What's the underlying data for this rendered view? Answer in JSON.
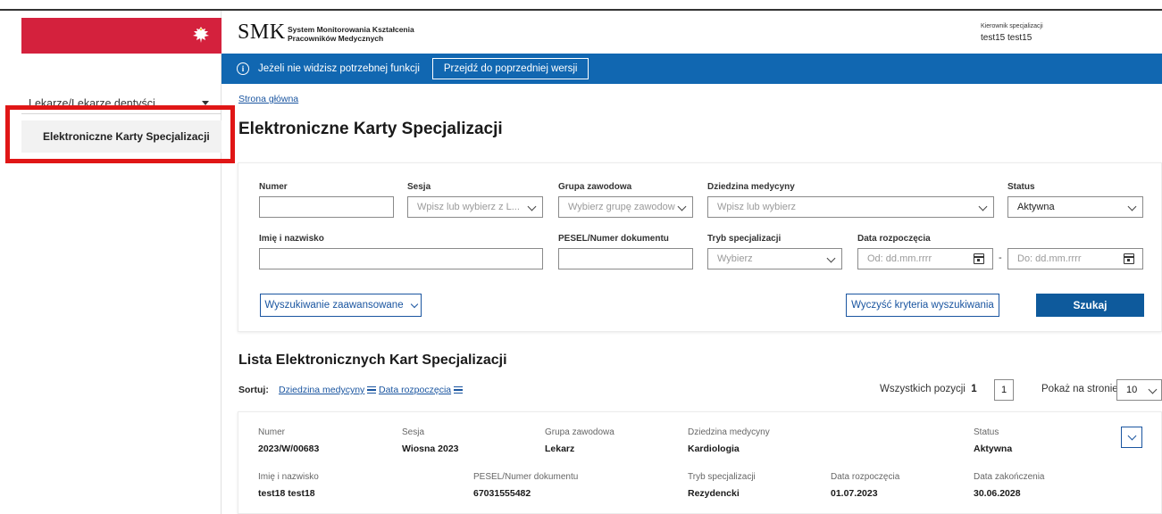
{
  "header": {
    "logo": "SMK",
    "subtitle_line1": "System Monitorowania Kształcenia",
    "subtitle_line2": "Pracowników Medycznych",
    "user_role": "Kierownik specjalizacji",
    "user_name": "test15 test15"
  },
  "info_bar": {
    "text": "Jeżeli nie widzisz potrzebnej funkcji",
    "button_label": "Przejdź do poprzedniej wersji"
  },
  "sidebar": {
    "group_label": "Lekarze/Lekarze dentyści",
    "items": [
      {
        "label": "Elektroniczne Karty Specjalizacji",
        "active": true
      }
    ]
  },
  "breadcrumb": "Strona główna",
  "page_title": "Elektroniczne Karty Specjalizacji",
  "search": {
    "numer_label": "Numer",
    "numer_value": "",
    "sesja_label": "Sesja",
    "sesja_placeholder": "Wpisz lub wybierz z L...",
    "grupa_label": "Grupa zawodowa",
    "grupa_placeholder": "Wybierz grupę zawodow",
    "dziedzina_label": "Dziedzina medycyny",
    "dziedzina_placeholder": "Wpisz lub wybierz",
    "status_label": "Status",
    "status_value": "Aktywna",
    "imie_label": "Imię i nazwisko",
    "imie_value": "",
    "pesel_label": "PESEL/Numer dokumentu",
    "pesel_value": "",
    "tryb_label": "Tryb specjalizacji",
    "tryb_placeholder": "Wybierz",
    "data_label": "Data rozpoczęcia",
    "data_od_placeholder": "Od: dd.mm.rrrr",
    "data_do_placeholder": "Do: dd.mm.rrrr",
    "date_separator": "-",
    "advanced_label": "Wyszukiwanie zaawansowane",
    "clear_label": "Wyczyść kryteria wyszukiwania",
    "search_label": "Szukaj"
  },
  "list": {
    "title": "Lista Elektronicznych Kart Specjalizacji",
    "sort_label": "Sortuj:",
    "sort_options": [
      "Dziedzina medycyny",
      "Data rozpoczęcia"
    ],
    "total_label": "Wszystkich pozycji",
    "total_count": "1",
    "page_number": "1",
    "per_page_label": "Pokaż na stronie",
    "per_page_value": "10",
    "records": [
      {
        "numer_label": "Numer",
        "numer": "2023/W/00683",
        "sesja_label": "Sesja",
        "sesja": "Wiosna 2023",
        "grupa_label": "Grupa zawodowa",
        "grupa": "Lekarz",
        "dziedzina_label": "Dziedzina medycyny",
        "dziedzina": "Kardiologia",
        "status_label": "Status",
        "status": "Aktywna",
        "imie_label": "Imię i nazwisko",
        "imie": "test18 test18",
        "pesel_label": "PESEL/Numer dokumentu",
        "pesel": "67031555482",
        "tryb_label": "Tryb specjalizacji",
        "tryb": "Rezydencki",
        "data_rozp_label": "Data rozpoczęcia",
        "data_rozp": "01.07.2023",
        "data_zak_label": "Data zakończenia",
        "data_zak": "30.06.2028"
      }
    ]
  },
  "colors": {
    "brand_red": "#d4213d",
    "info_blue": "#1167b1",
    "primary_button": "#0e5a9c",
    "link_blue": "#1a55a0",
    "highlight_red": "#e01616"
  }
}
